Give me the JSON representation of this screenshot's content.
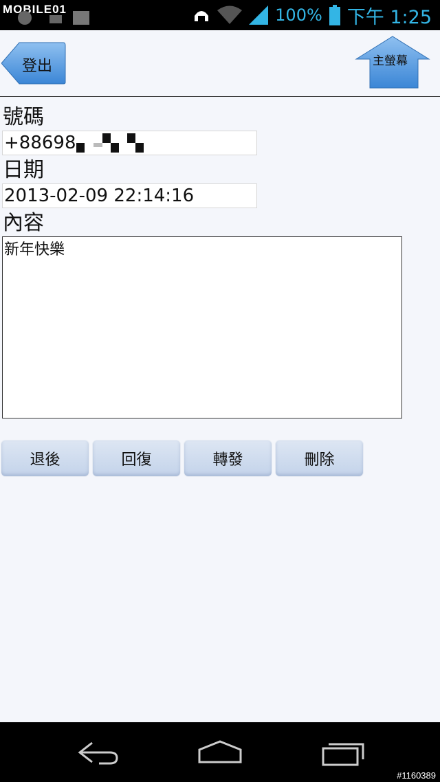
{
  "status_bar": {
    "watermark": "MOBILE01",
    "battery_percent": "100%",
    "time": "下午 1:25"
  },
  "header": {
    "back_label": "登出",
    "home_label": "主螢幕"
  },
  "form": {
    "number_label": "號碼",
    "number_value": "+88698",
    "date_label": "日期",
    "date_value": "2013-02-09 22:14:16",
    "content_label": "內容",
    "content_value": "新年快樂"
  },
  "actions": {
    "back": "退後",
    "reply": "回復",
    "forward": "轉發",
    "delete": "刪除"
  },
  "navbar": {
    "credit": "#1160389"
  },
  "colors": {
    "accent": "#33b5e5",
    "button_blue": "#4a90d9",
    "background": "#f4f6fb"
  }
}
